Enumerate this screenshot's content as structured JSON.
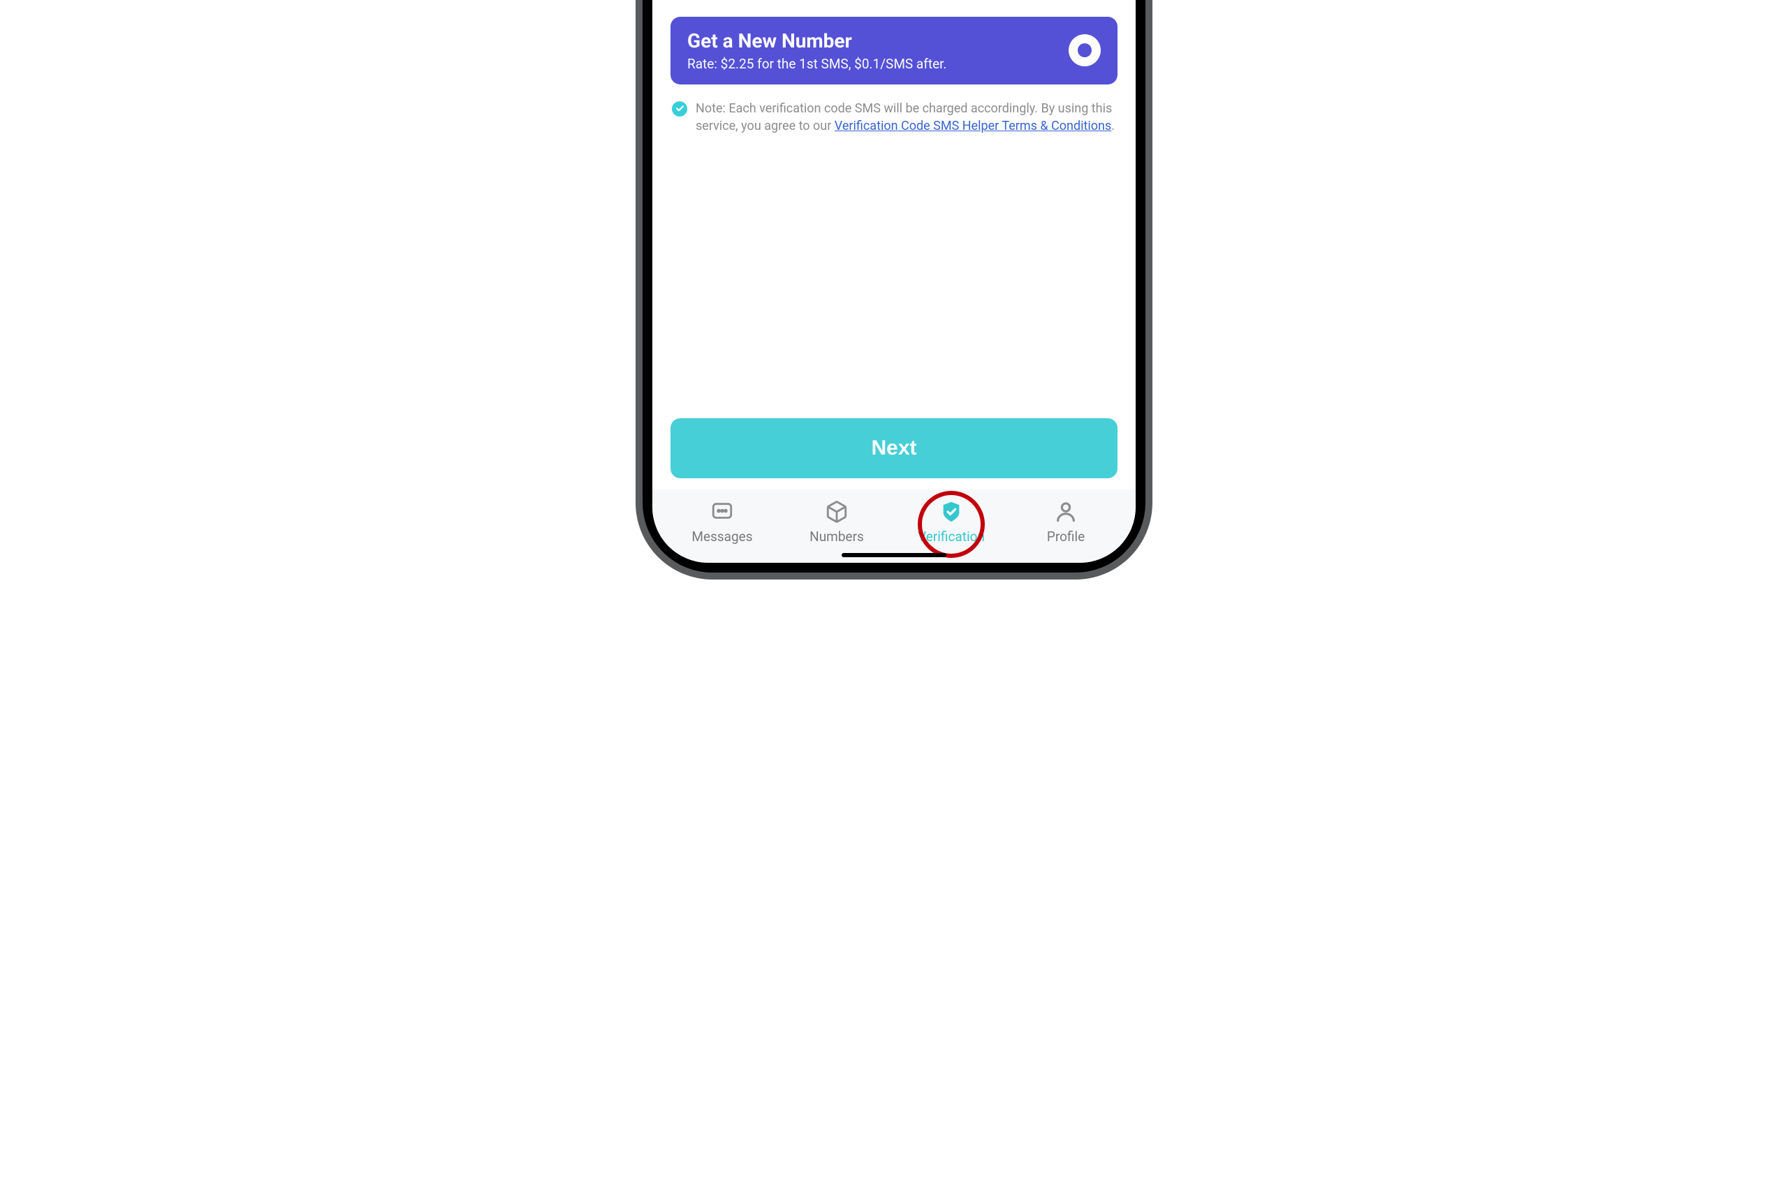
{
  "banner": {
    "title": "Get a New Number",
    "subtitle": "Rate: $2.25 for the 1st SMS, $0.1/SMS after."
  },
  "note": {
    "prefix": "Note: Each verification code SMS will be charged accordingly. By using this service, you agree to our ",
    "link_text": "Verification Code SMS Helper Terms & Conditions",
    "suffix": "."
  },
  "next_button": "Next",
  "tabs": {
    "messages": "Messages",
    "numbers": "Numbers",
    "verification": "Verification",
    "profile": "Profile"
  },
  "colors": {
    "banner_bg": "#5451d6",
    "accent": "#46cfd6",
    "link": "#3763d1",
    "highlight_ring": "#c2000b"
  }
}
